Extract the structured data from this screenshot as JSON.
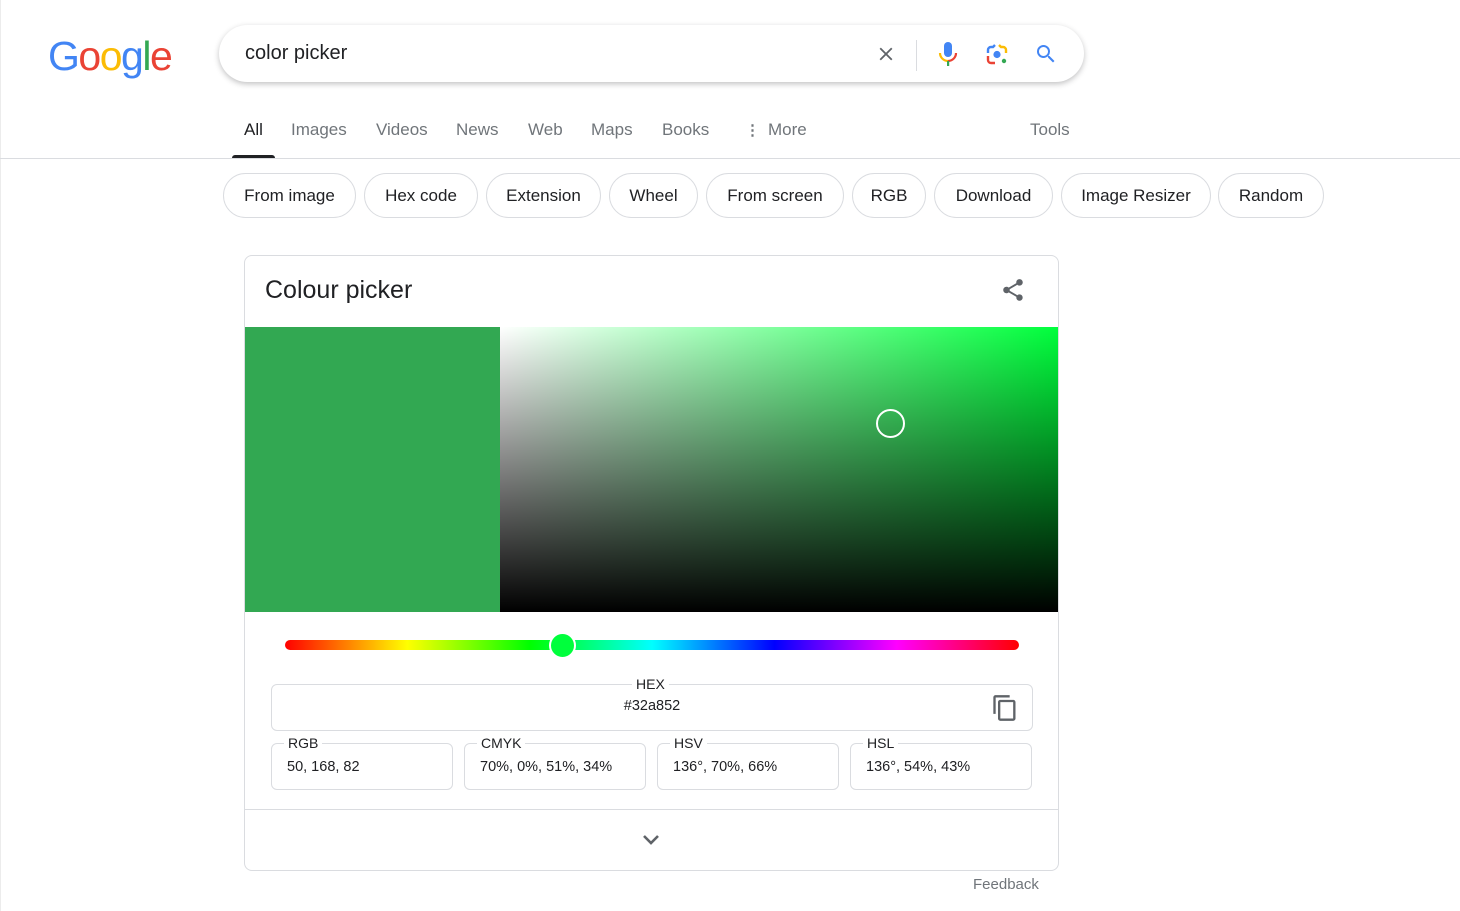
{
  "logo": {
    "text": "Google",
    "letters": [
      {
        "ch": "G",
        "color": "#4285F4"
      },
      {
        "ch": "o",
        "color": "#EA4335"
      },
      {
        "ch": "o",
        "color": "#FBBC05"
      },
      {
        "ch": "g",
        "color": "#4285F4"
      },
      {
        "ch": "l",
        "color": "#34A853"
      },
      {
        "ch": "e",
        "color": "#EA4335"
      }
    ]
  },
  "search": {
    "query": "color picker",
    "icons": {
      "clear": "close-icon",
      "voice": "microphone-icon",
      "lens": "camera-lens-icon",
      "submit": "search-icon"
    }
  },
  "tabs": [
    {
      "label": "All",
      "active": true
    },
    {
      "label": "Images",
      "active": false
    },
    {
      "label": "Videos",
      "active": false
    },
    {
      "label": "News",
      "active": false
    },
    {
      "label": "Web",
      "active": false
    },
    {
      "label": "Maps",
      "active": false
    },
    {
      "label": "Books",
      "active": false
    },
    {
      "label": "More",
      "active": false,
      "icon": "vertical-dots-icon"
    }
  ],
  "tools_label": "Tools",
  "chips": [
    {
      "label": "From image"
    },
    {
      "label": "Hex code"
    },
    {
      "label": "Extension"
    },
    {
      "label": "Wheel"
    },
    {
      "label": "From screen"
    },
    {
      "label": "RGB"
    },
    {
      "label": "Download"
    },
    {
      "label": "Image Resizer"
    },
    {
      "label": "Random"
    }
  ],
  "picker": {
    "title": "Colour picker",
    "share_icon": "share-icon",
    "selected_color": "#32a852",
    "hue_degrees": 136,
    "hue_color": "#00ff3c",
    "saturation": 0.7,
    "value": 0.66,
    "hex": {
      "label": "HEX",
      "value": "#32a852",
      "copy_icon": "copy-icon"
    },
    "fields": [
      {
        "label": "RGB",
        "value": "50, 168, 82"
      },
      {
        "label": "CMYK",
        "value": "70%, 0%, 51%, 34%"
      },
      {
        "label": "HSV",
        "value": "136°, 70%, 66%"
      },
      {
        "label": "HSL",
        "value": "136°, 54%, 43%"
      }
    ],
    "expand_icon": "chevron-down-icon"
  },
  "feedback_label": "Feedback"
}
